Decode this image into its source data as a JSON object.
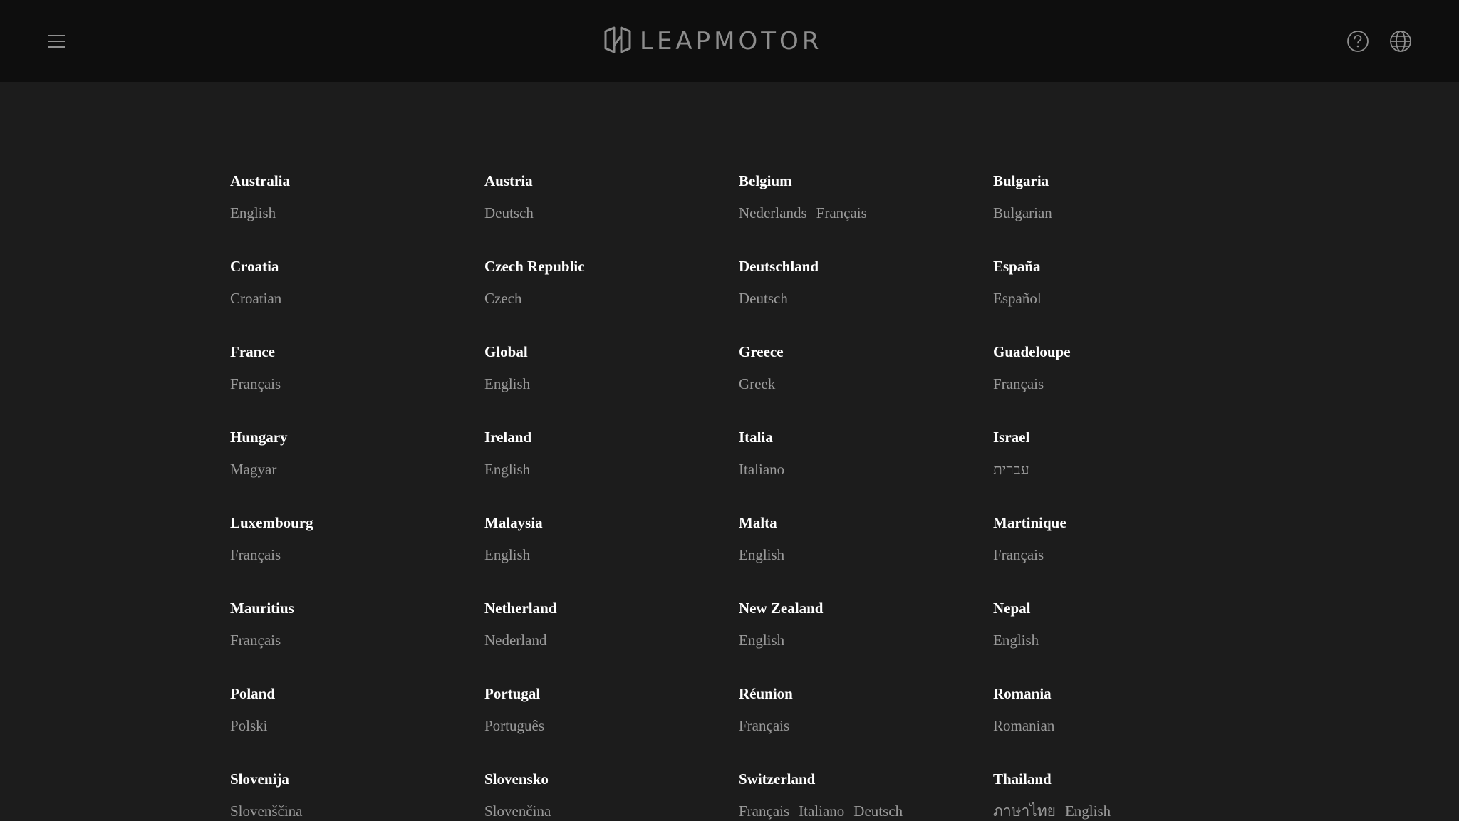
{
  "header": {
    "brand": "LEAPMOTOR"
  },
  "regions": [
    {
      "country": "Australia",
      "languages": [
        "English"
      ]
    },
    {
      "country": "Austria",
      "languages": [
        "Deutsch"
      ]
    },
    {
      "country": "Belgium",
      "languages": [
        "Nederlands",
        "Français"
      ]
    },
    {
      "country": "Bulgaria",
      "languages": [
        "Bulgarian"
      ]
    },
    {
      "country": "Croatia",
      "languages": [
        "Croatian"
      ]
    },
    {
      "country": "Czech Republic",
      "languages": [
        "Czech"
      ]
    },
    {
      "country": "Deutschland",
      "languages": [
        "Deutsch"
      ]
    },
    {
      "country": "España",
      "languages": [
        "Español"
      ]
    },
    {
      "country": "France",
      "languages": [
        "Français"
      ]
    },
    {
      "country": "Global",
      "languages": [
        "English"
      ]
    },
    {
      "country": "Greece",
      "languages": [
        "Greek"
      ]
    },
    {
      "country": "Guadeloupe",
      "languages": [
        "Français"
      ]
    },
    {
      "country": "Hungary",
      "languages": [
        "Magyar"
      ]
    },
    {
      "country": "Ireland",
      "languages": [
        "English"
      ]
    },
    {
      "country": "Italia",
      "languages": [
        "Italiano"
      ]
    },
    {
      "country": "Israel",
      "languages": [
        "עברית"
      ]
    },
    {
      "country": "Luxembourg",
      "languages": [
        "Français"
      ]
    },
    {
      "country": "Malaysia",
      "languages": [
        "English"
      ]
    },
    {
      "country": "Malta",
      "languages": [
        "English"
      ]
    },
    {
      "country": "Martinique",
      "languages": [
        "Français"
      ]
    },
    {
      "country": "Mauritius",
      "languages": [
        "Français"
      ]
    },
    {
      "country": "Netherland",
      "languages": [
        "Nederland"
      ]
    },
    {
      "country": "New Zealand",
      "languages": [
        "English"
      ]
    },
    {
      "country": "Nepal",
      "languages": [
        "English"
      ]
    },
    {
      "country": "Poland",
      "languages": [
        "Polski"
      ]
    },
    {
      "country": "Portugal",
      "languages": [
        "Português"
      ]
    },
    {
      "country": "Réunion",
      "languages": [
        "Français"
      ]
    },
    {
      "country": "Romania",
      "languages": [
        "Romanian"
      ]
    },
    {
      "country": "Slovenija",
      "languages": [
        "Slovenščina"
      ]
    },
    {
      "country": "Slovensko",
      "languages": [
        "Slovenčina"
      ]
    },
    {
      "country": "Switzerland",
      "languages": [
        "Français",
        "Italiano",
        "Deutsch"
      ]
    },
    {
      "country": "Thailand",
      "languages": [
        "ภาษาไทย",
        "English"
      ]
    }
  ]
}
